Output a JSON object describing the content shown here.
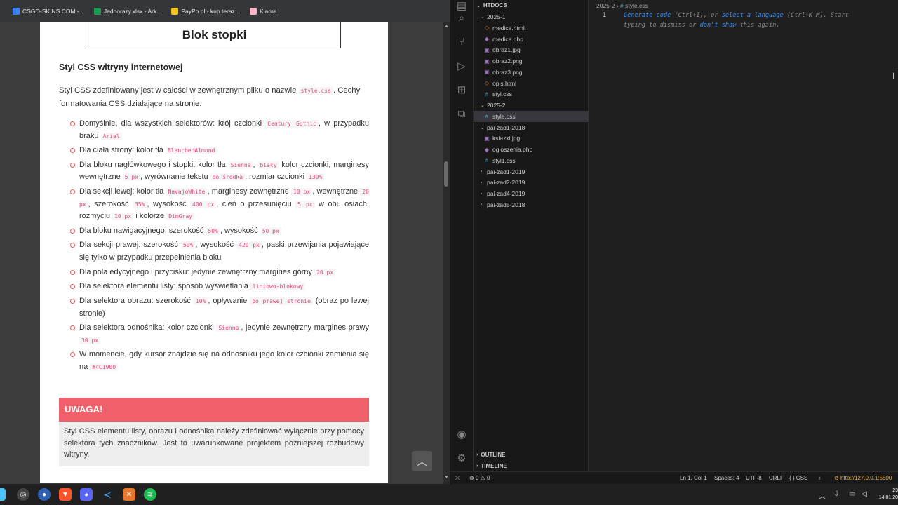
{
  "bookmarks": [
    {
      "label": "CSGO-SKINS.COM -...",
      "color": "#3b82f6"
    },
    {
      "label": "Jednorazy.xlsx - Ark...",
      "color": "#1e9c55"
    },
    {
      "label": "PayPo.pl - kup teraz...",
      "color": "#f4c21b"
    },
    {
      "label": "Klarna",
      "color": "#ffb3c7"
    }
  ],
  "page": {
    "footer_block": "Blok stopki",
    "heading": "Styl CSS witryny internetowej",
    "intro_prefix": "Styl CSS zdefiniowany jest w całości w zewnętrznym pliku o nazwie",
    "intro_code": "style.css",
    "intro_suffix": ". Cechy formatowania CSS działające na stronie:",
    "list": [
      [
        "Domyślnie, dla wszystkich selektorów: krój czcionki ",
        {
          "c": "Century Gothic"
        },
        ", w przypadku braku ",
        {
          "c": "Arial"
        }
      ],
      [
        "Dla ciała strony: kolor tła ",
        {
          "c": "BlanchedAlmond"
        }
      ],
      [
        "Dla bloku nagłówkowego i stopki: kolor tła ",
        {
          "c": "Sienna"
        },
        ", ",
        {
          "c": "biały"
        },
        " kolor czcionki, marginesy wewnętrzne ",
        {
          "c": "5 px"
        },
        ", wyrównanie tekstu ",
        {
          "c": "do środka"
        },
        ", rozmiar czcionki ",
        {
          "c": "130%"
        }
      ],
      [
        "Dla sekcji lewej: kolor tła ",
        {
          "c": "NavajoWhite"
        },
        ", marginesy zewnętrzne ",
        {
          "c": "10 px"
        },
        ", wewnętrzne ",
        {
          "c": "20 px"
        },
        ", szerokość ",
        {
          "c": "35%"
        },
        ", wysokość ",
        {
          "c": "400 px"
        },
        ", cień o przesunięciu ",
        {
          "c": "5 px"
        },
        " w obu osiach, rozmyciu ",
        {
          "c": "10 px"
        },
        " i kolorze ",
        {
          "c": "DimGray"
        }
      ],
      [
        "Dla bloku nawigacyjnego: szerokość ",
        {
          "c": "50%"
        },
        ", wysokość ",
        {
          "c": "50 px"
        }
      ],
      [
        "Dla sekcji prawej: szerokość ",
        {
          "c": "50%"
        },
        ", wysokość ",
        {
          "c": "420 px"
        },
        ", paski przewijania pojawiające się tylko w przypadku przepełnienia bloku"
      ],
      [
        "Dla pola edycyjnego i przycisku: jedynie zewnętrzny margines górny ",
        {
          "c": "20 px"
        }
      ],
      [
        "Dla selektora elementu listy: sposób wyświetlania ",
        {
          "c": "liniowo-blokowy"
        }
      ],
      [
        "Dla selektora obrazu: szerokość ",
        {
          "c": "10%"
        },
        ", opływanie ",
        {
          "c": "po prawej stronie"
        },
        " (obraz po lewej stronie)"
      ],
      [
        "Dla selektora odnośnika: kolor czcionki ",
        {
          "c": "Sienna"
        },
        ", jedynie zewnętrzny margines prawy ",
        {
          "c": "30 px"
        }
      ],
      [
        "W momencie, gdy kursor znajdzie się na odnośniku jego kolor czcionki zamienia się na ",
        {
          "c": "#4C1900"
        }
      ]
    ],
    "warning_title": "UWAGA!",
    "warning_text": "Styl CSS elementu listy, obrazu i odnośnika należy zdefiniować wyłącznie przy pomocy selektora tych znaczników. Jest to uwarunkowane projektem późniejszej rozbudowy witryny."
  },
  "explorer": {
    "root": "HTDOCS",
    "rows": [
      {
        "label": "2025-1",
        "type": "folder-open",
        "indent": 1
      },
      {
        "label": "medica.html",
        "type": "html",
        "indent": 2
      },
      {
        "label": "medica.php",
        "type": "php",
        "indent": 2
      },
      {
        "label": "obraz1.jpg",
        "type": "img",
        "indent": 2
      },
      {
        "label": "obraz2.png",
        "type": "img",
        "indent": 2
      },
      {
        "label": "obraz3.png",
        "type": "img",
        "indent": 2
      },
      {
        "label": "opis.html",
        "type": "html",
        "indent": 2
      },
      {
        "label": "styl.css",
        "type": "css",
        "indent": 2
      },
      {
        "label": "2025-2",
        "type": "folder-open",
        "indent": 1
      },
      {
        "label": "style.css",
        "type": "css",
        "indent": 2,
        "selected": true
      },
      {
        "label": "pai-zad1-2018",
        "type": "folder-open",
        "indent": 1
      },
      {
        "label": "ksiazki.jpg",
        "type": "img",
        "indent": 2
      },
      {
        "label": "ogloszenia.php",
        "type": "php",
        "indent": 2
      },
      {
        "label": "styl1.css",
        "type": "css",
        "indent": 2
      },
      {
        "label": "pai-zad1-2019",
        "type": "folder",
        "indent": 1
      },
      {
        "label": "pai-zad2-2019",
        "type": "folder",
        "indent": 1
      },
      {
        "label": "pai-zad4-2019",
        "type": "folder",
        "indent": 1
      },
      {
        "label": "pai-zad5-2018",
        "type": "folder",
        "indent": 1
      }
    ],
    "outline": "OUTLINE",
    "timeline": "TIMELINE"
  },
  "editor": {
    "breadcrumb_folder": "2025-2",
    "breadcrumb_file": "style.css",
    "line_number": "1",
    "hint": [
      {
        "t": "Generate code",
        "lnk": true
      },
      {
        "t": " (Ctrl+I), or "
      },
      {
        "t": "select a language",
        "lnk": true
      },
      {
        "t": " (Ctrl+K M). Start typing to dismiss or "
      },
      {
        "t": "don't show",
        "lnk": true
      },
      {
        "t": " this again."
      }
    ]
  },
  "status": {
    "errors": "0",
    "warnings": "0",
    "position": "Ln 1, Col 1",
    "spaces": "Spaces: 4",
    "encoding": "UTF-8",
    "eol": "CRLF",
    "language": "{ } CSS",
    "live_server": "http://127.0.0.1:5500"
  },
  "clock": {
    "time": "23",
    "date": "14.01.20"
  }
}
